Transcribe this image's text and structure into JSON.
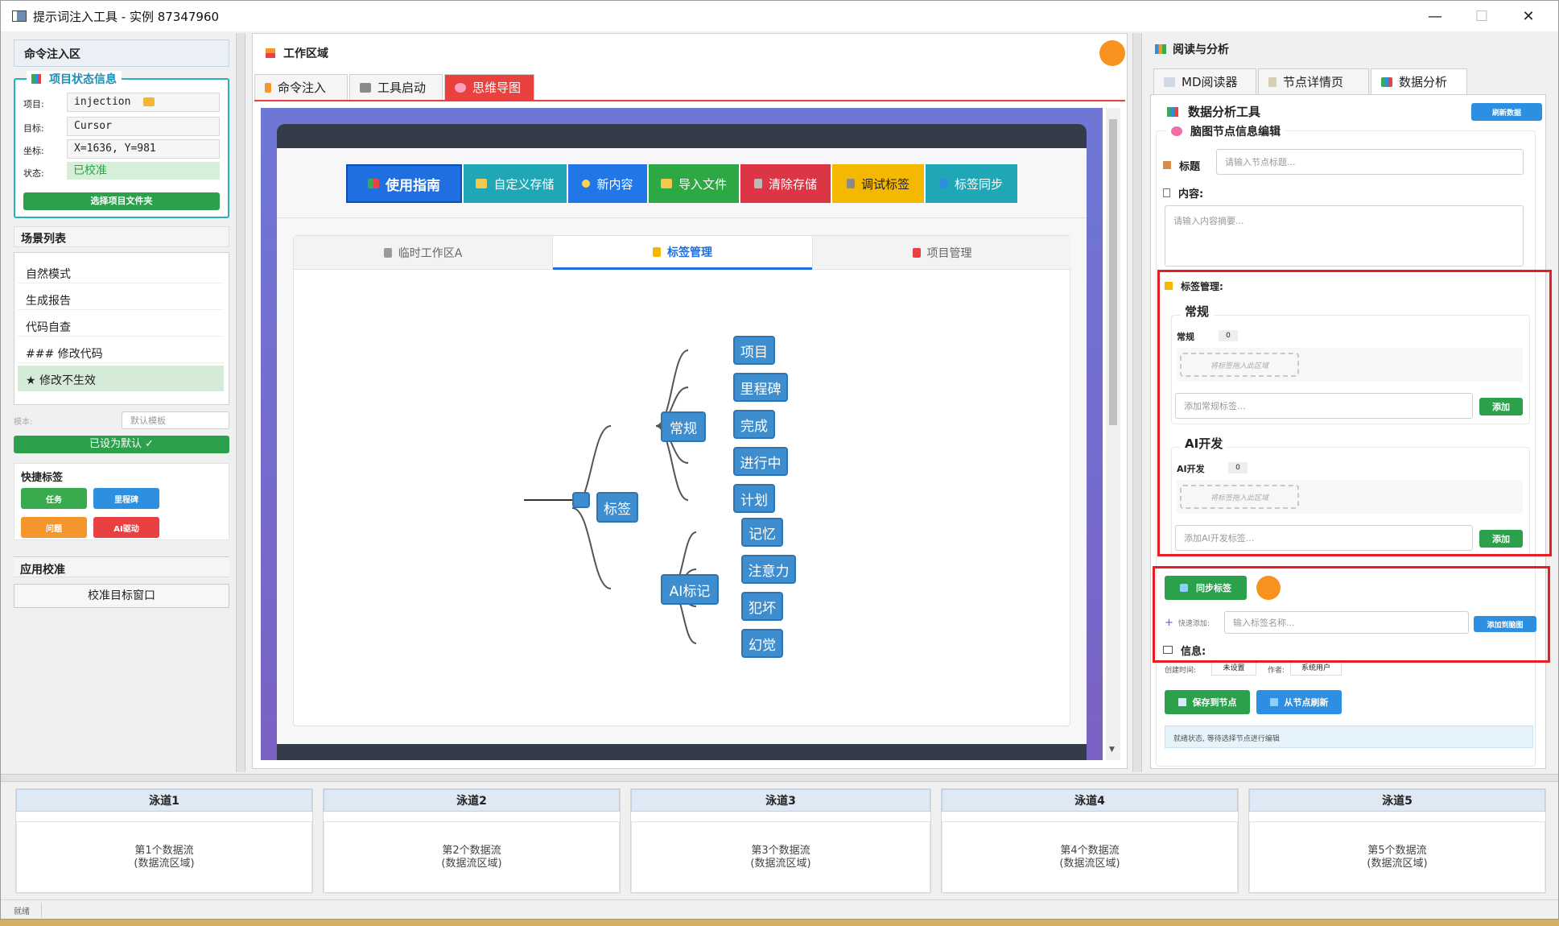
{
  "window": {
    "title": "提示词注入工具 - 实例 87347960"
  },
  "left": {
    "cmd_header": "命令注入区",
    "status": {
      "title": "项目状态信息",
      "rows": [
        {
          "label": "项目:",
          "value": "injection"
        },
        {
          "label": "目标:",
          "value": "Cursor"
        },
        {
          "label": "坐标:",
          "value": "X=1636, Y=981"
        },
        {
          "label": "状态:",
          "value": "已校准"
        }
      ],
      "select_btn": "选择项目文件夹"
    },
    "scene_header": "场景列表",
    "scenes": [
      "自然模式",
      "生成报告",
      "代码自查",
      "### 修改代码",
      "★ 修改不生效"
    ],
    "template_label": "模本:",
    "template_placeholder": "默认模板",
    "default_btn": "已设为默认 ✓",
    "quick_header": "快捷标签",
    "quick_tags": [
      {
        "label": "任务",
        "color": "#3aaa4e"
      },
      {
        "label": "里程碑",
        "color": "#2d8fe2"
      },
      {
        "label": "问题",
        "color": "#f5962c"
      },
      {
        "label": "AI驱动",
        "color": "#e94141"
      }
    ],
    "calib_header": "应用校准",
    "calib_btn": "校准目标窗口"
  },
  "work": {
    "title": "工作区域",
    "tabs": [
      {
        "label": "命令注入",
        "icon": "lightning-icon"
      },
      {
        "label": "工具启动",
        "icon": "tools-icon"
      },
      {
        "label": "思维导图",
        "icon": "brain-icon"
      }
    ],
    "toolbar": [
      {
        "label": "使用指南",
        "color": "#1f6fe0",
        "icon": "book-icon"
      },
      {
        "label": "自定义存储",
        "color": "#1fa7b5",
        "icon": "folder-icon"
      },
      {
        "label": "新内容",
        "color": "#2277e8",
        "icon": "sparkle-icon"
      },
      {
        "label": "导入文件",
        "color": "#2ea845",
        "icon": "folder-icon"
      },
      {
        "label": "清除存储",
        "color": "#dc3545",
        "icon": "trash-icon"
      },
      {
        "label": "调试标签",
        "color": "#f5b800",
        "icon": "wrench-icon"
      },
      {
        "label": "标签同步",
        "color": "#1fa7b5",
        "icon": "sync-icon"
      }
    ],
    "inner_tabs": [
      "临时工作区A",
      "标签管理",
      "项目管理"
    ],
    "mindmap": {
      "root": "标签",
      "branches": [
        {
          "label": "常规",
          "children": [
            "项目",
            "里程碑",
            "完成",
            "进行中",
            "计划"
          ]
        },
        {
          "label": "AI标记",
          "children": [
            "记忆",
            "注意力",
            "犯坏",
            "幻觉"
          ]
        }
      ]
    }
  },
  "right": {
    "title": "阅读与分析",
    "tabs": [
      "MD阅读器",
      "节点详情页",
      "数据分析"
    ],
    "tool_title": "数据分析工具",
    "refresh_btn": "刷新数据",
    "edit_title": "脑图节点信息编辑",
    "title_label": "标题",
    "title_placeholder": "请输入节点标题...",
    "content_label": "内容:",
    "content_placeholder": "请输入内容摘要...",
    "tag_mgmt": "标签管理:",
    "groups": [
      {
        "name": "常规",
        "label": "常规",
        "count": "0",
        "drop_hint": "将标签拖入此区域",
        "input_placeholder": "添加常规标签...",
        "add_btn": "添加"
      },
      {
        "name": "AI开发",
        "label": "AI开发",
        "count": "0",
        "drop_hint": "将标签拖入此区域",
        "input_placeholder": "添加AI开发标签...",
        "add_btn": "添加"
      }
    ],
    "sync_btn": "同步标签",
    "quick_add_label": "快速添加:",
    "quick_add_placeholder": "输入标签名称...",
    "add_mindmap_btn": "添加到脑图",
    "info_label": "信息:",
    "created_label": "创建时间:",
    "created_value": "未设置",
    "author_label": "作者:",
    "author_value": "系统用户",
    "save_btn": "保存到节点",
    "refresh_node_btn": "从节点刷新",
    "status_text": "就绪状态, 等待选择节点进行编辑"
  },
  "lanes": [
    {
      "title": "泳道1",
      "line1": "第1个数据流",
      "line2": "(数据流区域)"
    },
    {
      "title": "泳道2",
      "line1": "第2个数据流",
      "line2": "(数据流区域)"
    },
    {
      "title": "泳道3",
      "line1": "第3个数据流",
      "line2": "(数据流区域)"
    },
    {
      "title": "泳道4",
      "line1": "第4个数据流",
      "line2": "(数据流区域)"
    },
    {
      "title": "泳道5",
      "line1": "第5个数据流",
      "line2": "(数据流区域)"
    }
  ],
  "statusbar": {
    "text": "就绪"
  }
}
